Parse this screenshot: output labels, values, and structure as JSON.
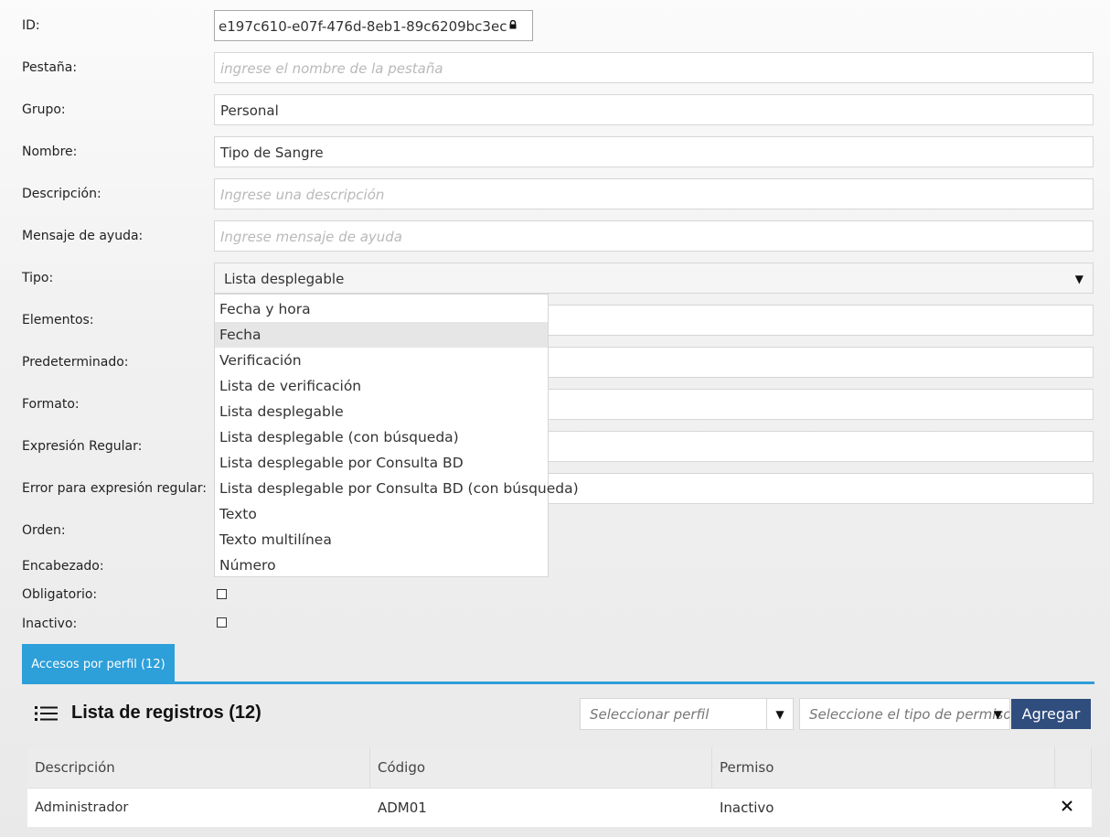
{
  "form": {
    "id": {
      "label": "ID:",
      "value": "e197c610-e07f-476d-8eb1-89c6209bc3ec"
    },
    "pestana": {
      "label": "Pestaña:",
      "placeholder": "ingrese el nombre de la pestaña"
    },
    "grupo": {
      "label": "Grupo:",
      "value": "Personal"
    },
    "nombre": {
      "label": "Nombre:",
      "value": "Tipo de Sangre"
    },
    "descripcion": {
      "label": "Descripción:",
      "placeholder": "Ingrese una descripción"
    },
    "mensaje": {
      "label": "Mensaje de ayuda:",
      "placeholder": "Ingrese mensaje de ayuda"
    },
    "tipo": {
      "label": "Tipo:",
      "value": "Lista desplegable"
    },
    "elementos": {
      "label": "Elementos:"
    },
    "predeterminado": {
      "label": "Predeterminado:"
    },
    "formato": {
      "label": "Formato:"
    },
    "expresion": {
      "label": "Expresión Regular:"
    },
    "error_expresion": {
      "label": "Error para expresión regular:"
    },
    "orden": {
      "label": "Orden:"
    },
    "encabezado": {
      "label": "Encabezado:"
    },
    "obligatorio": {
      "label": "Obligatorio:",
      "checked": false
    },
    "inactivo": {
      "label": "Inactivo:",
      "checked": false
    }
  },
  "tipo_dropdown": {
    "options": [
      "Fecha y hora",
      "Fecha",
      "Verificación",
      "Lista de verificación",
      "Lista desplegable",
      "Lista desplegable (con búsqueda)",
      "Lista desplegable por Consulta BD",
      "Lista desplegable por Consulta BD (con búsqueda)",
      "Texto",
      "Texto multilínea",
      "Número"
    ],
    "hovered": "Fecha"
  },
  "tabs": [
    {
      "label": "Accesos por perfil (12)",
      "active": true
    }
  ],
  "records": {
    "title": "Lista de registros (12)",
    "profile_select": {
      "placeholder": "Seleccionar perfil"
    },
    "permission_select": {
      "placeholder": "Seleccione el tipo de permiso"
    },
    "add_button": "Agregar",
    "columns": [
      "Descripción",
      "Código",
      "Permiso"
    ],
    "rows": [
      {
        "descripcion": "Administrador",
        "codigo": "ADM01",
        "permiso": "Inactivo"
      }
    ]
  },
  "icons": {
    "lock": "lock-icon",
    "list": "list-icon",
    "delete": "close-icon",
    "dropdown": "caret-down-icon"
  },
  "colors": {
    "tab_active": "#2d9fd9",
    "button_primary": "#2f4d7d",
    "dropdown_hover": "#e6e6e6"
  }
}
